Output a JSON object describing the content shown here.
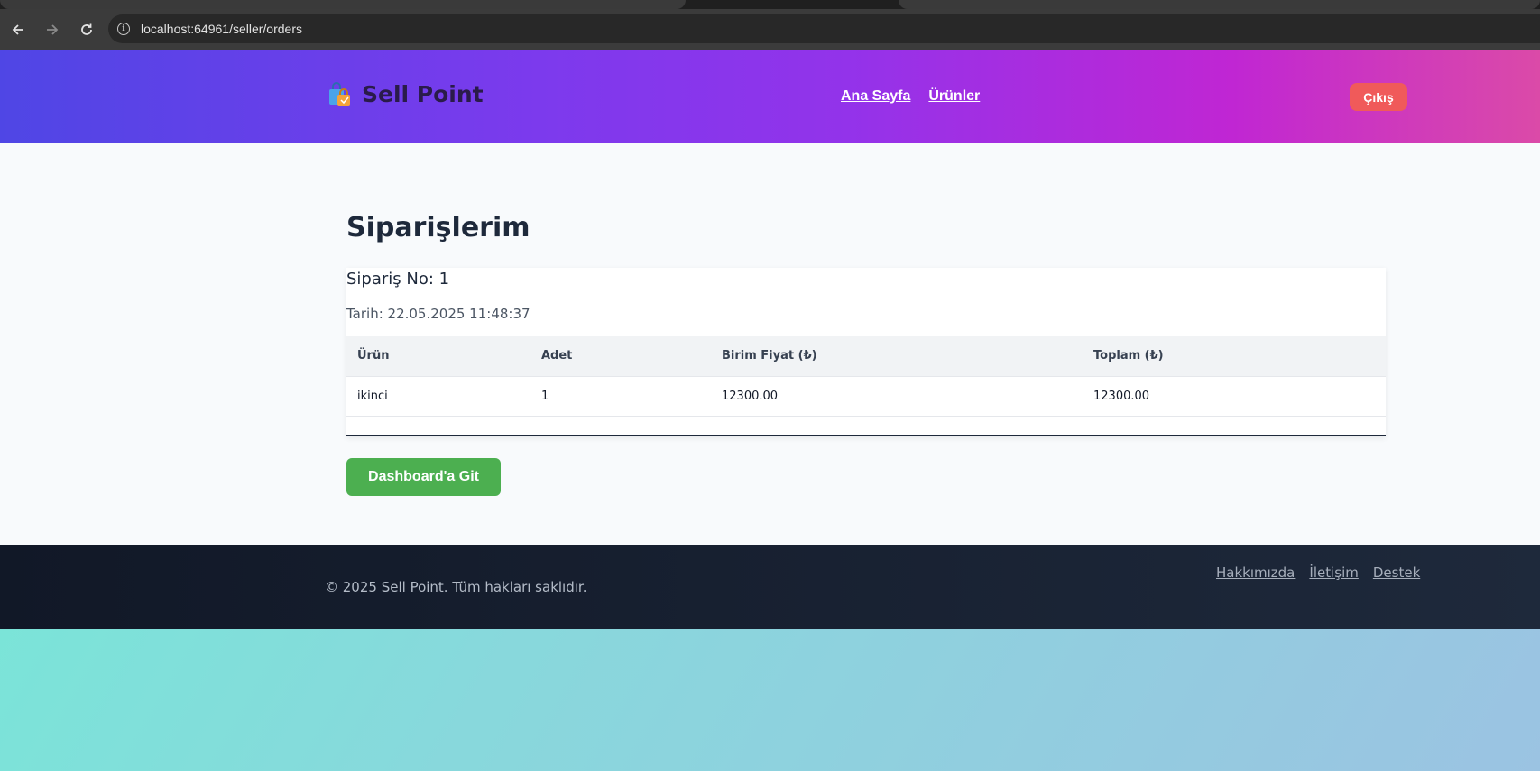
{
  "browser": {
    "url": "localhost:64961/seller/orders",
    "back_icon": "arrow-left-icon",
    "forward_icon": "arrow-right-icon",
    "reload_icon": "reload-icon",
    "info_icon": "info-icon"
  },
  "header": {
    "brand": "Sell Point",
    "brand_icon": "shopping-bags-icon",
    "nav": [
      "Ana Sayfa",
      "Ürünler"
    ],
    "logout": "Çıkış"
  },
  "main": {
    "title": "Siparişlerim",
    "order": {
      "number": "Sipariş No: 1",
      "date": "Tarih: 22.05.2025 11:48:37",
      "columns": [
        "Ürün",
        "Adet",
        "Birim Fiyat (₺)",
        "Toplam (₺)"
      ],
      "rows": [
        [
          "ikinci",
          "1",
          "12300.00",
          "12300.00"
        ]
      ]
    },
    "dashboard_button": "Dashboard'a Git"
  },
  "footer": {
    "copyright": "© 2025 Sell Point. Tüm hakları saklıdır.",
    "links": [
      "Hakkımızda",
      "İletişim",
      "Destek"
    ]
  },
  "colors": {
    "header_start": "#4f46e5",
    "header_end": "#db4aa8",
    "logout": "#f05a5a",
    "dashboard_button": "#4caf50",
    "footer": "#111827"
  }
}
